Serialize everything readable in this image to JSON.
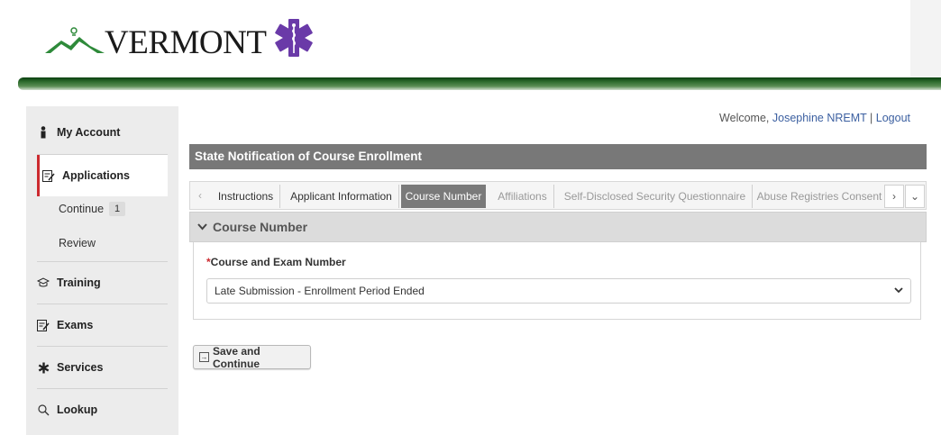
{
  "header": {
    "logo_text": "VERMONT"
  },
  "welcome": {
    "prefix": "Welcome, ",
    "user": "Josephine NREMT",
    "separator": " | ",
    "logout": "Logout"
  },
  "sidebar": {
    "my_account": "My Account",
    "applications": "Applications",
    "continue": "Continue",
    "continue_count": "1",
    "review": "Review",
    "training": "Training",
    "exams": "Exams",
    "services": "Services",
    "lookup": "Lookup"
  },
  "panel": {
    "title": "State Notification of Course Enrollment"
  },
  "tabs": [
    {
      "label": "Instructions"
    },
    {
      "label": "Applicant Information"
    },
    {
      "label": "Course Number"
    },
    {
      "label": "Affiliations"
    },
    {
      "label": "Self-Disclosed Security Questionnaire"
    },
    {
      "label": "Abuse Registries Consent"
    }
  ],
  "section": {
    "title": "Course Number",
    "field_required": "*",
    "field_label": "Course and Exam Number",
    "selected_value": "Late Submission - Enrollment Period Ended"
  },
  "actions": {
    "save_continue": "Save and Continue"
  },
  "colors": {
    "active_accent": "#cc2a2f",
    "header_green": "#2f6d2f",
    "star_purple": "#6a3aa8",
    "panel_gray": "#787878"
  }
}
